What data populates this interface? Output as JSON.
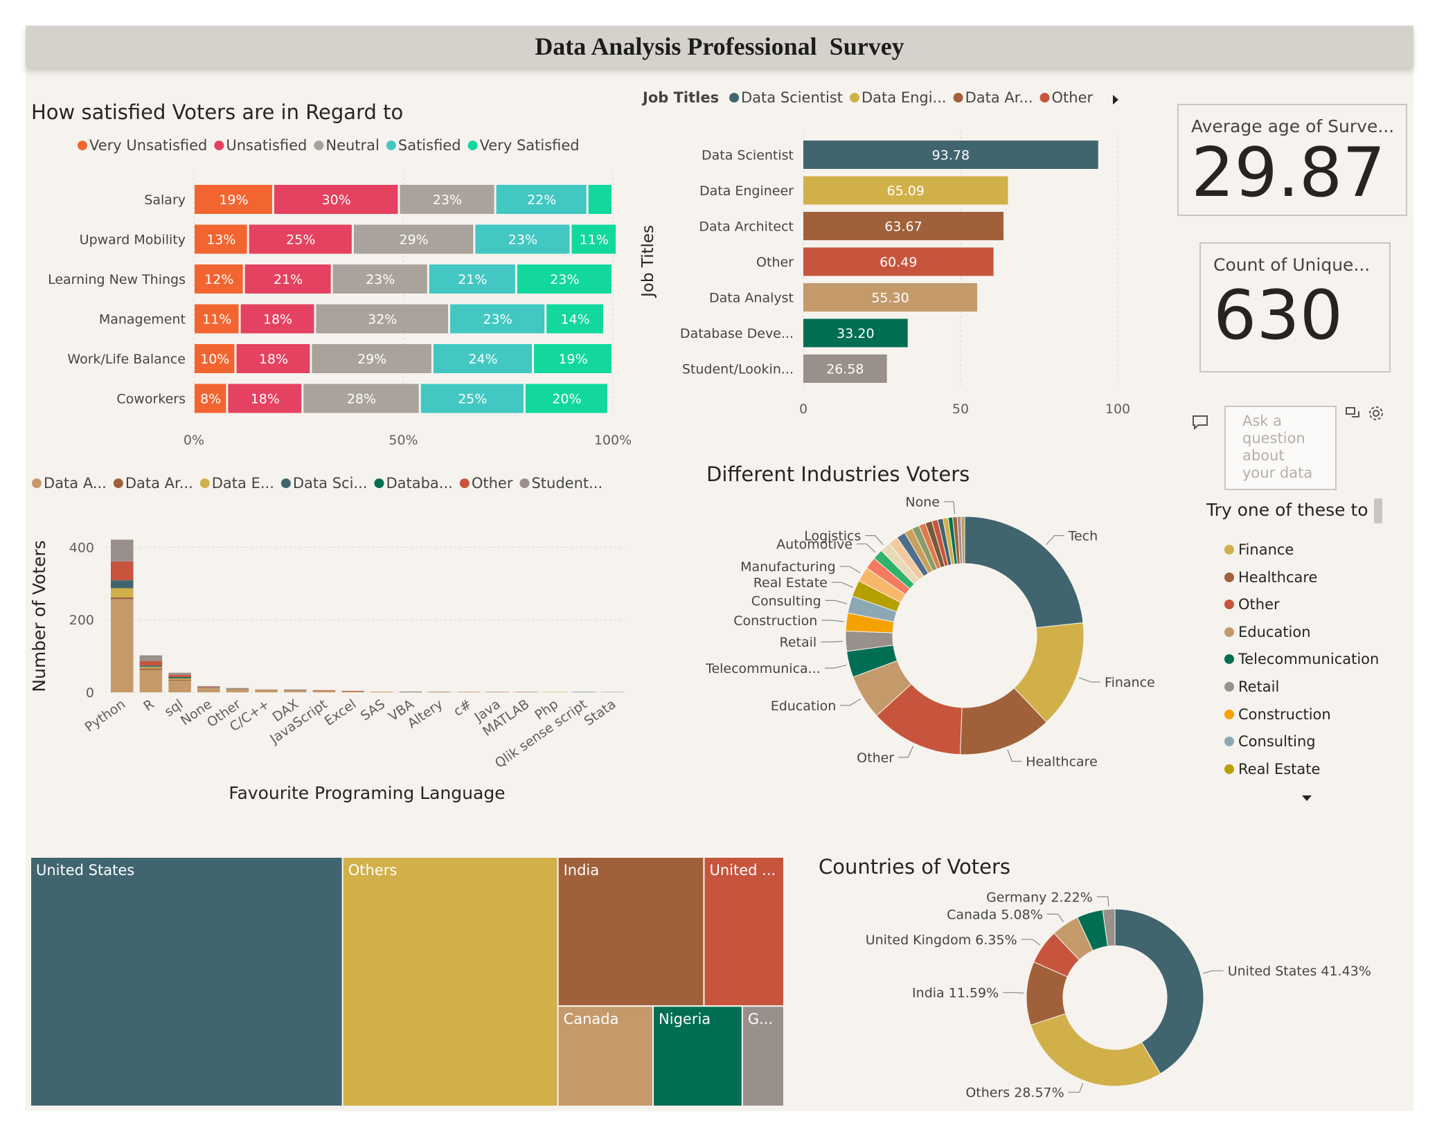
{
  "report": {
    "title": "Data Analysis Professional  Survey"
  },
  "colors": {
    "canvas": "#f6f3ee",
    "dark_teal": "#40656f",
    "gold": "#d1b04a",
    "brown": "#a0613a",
    "red": "#c7553d",
    "tan": "#c49a6a",
    "green": "#006e53",
    "gray": "#9a908a",
    "very_unsatisfied": "#f26531",
    "unsatisfied": "#e44260",
    "neutral": "#aaa39c",
    "satisfied": "#43c7c2",
    "very_satisfied": "#12d89d"
  },
  "satisfaction": {
    "title": "How satisfied Voters are in Regard to",
    "legend": [
      "Very Unsatisfied",
      "Unsatisfied",
      "Neutral",
      "Satisfied",
      "Very Satisfied"
    ],
    "legend_colors": [
      "#f26531",
      "#e44260",
      "#aaa39c",
      "#43c7c2",
      "#12d89d"
    ],
    "x_ticks": [
      "0%",
      "50%",
      "100%"
    ]
  },
  "job_titles": {
    "legend_title": "Job Titles",
    "legend": [
      "Data Scientist",
      "Data Engi...",
      "Data Ar...",
      "Other"
    ],
    "legend_colors": [
      "#40656f",
      "#d1b04a",
      "#a0613a",
      "#c7553d"
    ],
    "y_axis_title": "Job Titles",
    "x_ticks": [
      "0",
      "50",
      "100"
    ]
  },
  "avg_age_card": {
    "label": "Average age of Surve...",
    "value": "29.87"
  },
  "count_card": {
    "label": "Count of Unique...",
    "value": "630"
  },
  "languages": {
    "legend": [
      "Data A...",
      "Data Ar...",
      "Data E...",
      "Data Sci...",
      "Databa...",
      "Other",
      "Student..."
    ],
    "legend_colors": [
      "#c49a6a",
      "#a0613a",
      "#d1b04a",
      "#40656f",
      "#006e53",
      "#c7553d",
      "#9a908a"
    ],
    "x_axis_title": "Favourite Programing Language",
    "y_axis_title": "Number of Voters",
    "y_ticks": [
      "400",
      "200",
      "0"
    ]
  },
  "industries": {
    "title": "Different Industries Voters"
  },
  "countries_donut": {
    "title": "Countries of Voters"
  },
  "qna": {
    "placeholder": "Ask a question about your data",
    "try_text": "Try one of these to get started",
    "suggestions": [
      "Finance",
      "Healthcare",
      "Other",
      "Education",
      "Telecommunication",
      "Retail",
      "Construction",
      "Consulting",
      "Real Estate"
    ],
    "suggestion_colors": [
      "#d1b04a",
      "#a0613a",
      "#c7553d",
      "#c49a6a",
      "#006e53",
      "#9a908a",
      "#f5a100",
      "#8ca8b4",
      "#b5a000"
    ]
  },
  "chart_data": [
    {
      "type": "bar",
      "orientation": "horizontal",
      "stacked": "100%",
      "title": "How satisfied Voters are in Regard to",
      "categories": [
        "Salary",
        "Upward Mobility",
        "Learning New Things",
        "Management",
        "Work/Life Balance",
        "Coworkers"
      ],
      "series": [
        {
          "name": "Very Unsatisfied",
          "values": [
            19,
            13,
            12,
            11,
            10,
            8
          ],
          "labels": [
            "19%",
            "13%",
            "12%",
            "11%",
            "10%",
            "8%"
          ]
        },
        {
          "name": "Unsatisfied",
          "values": [
            30,
            25,
            21,
            18,
            18,
            18
          ],
          "labels": [
            "30%",
            "25%",
            "21%",
            "18%",
            "18%",
            "18%"
          ]
        },
        {
          "name": "Neutral",
          "values": [
            23,
            29,
            23,
            32,
            29,
            28
          ],
          "labels": [
            "23%",
            "29%",
            "23%",
            "32%",
            "29%",
            "28%"
          ]
        },
        {
          "name": "Satisfied",
          "values": [
            22,
            23,
            21,
            23,
            24,
            25
          ],
          "labels": [
            "22%",
            "23%",
            "21%",
            "23%",
            "24%",
            "25%"
          ]
        },
        {
          "name": "Very Satisfied",
          "values": [
            6,
            11,
            23,
            14,
            19,
            20
          ],
          "labels": [
            "",
            "11%",
            "23%",
            "14%",
            "19%",
            "20%"
          ]
        }
      ],
      "xlim": [
        0,
        100
      ],
      "grid": true,
      "legend": "top"
    },
    {
      "type": "bar",
      "orientation": "horizontal",
      "categories": [
        "Data Scientist",
        "Data Engineer",
        "Data Architect",
        "Other",
        "Data Analyst",
        "Database Deve...",
        "Student/Lookin..."
      ],
      "values": [
        93.78,
        65.09,
        63.67,
        60.49,
        55.3,
        33.2,
        26.58
      ],
      "labels": [
        "93.78",
        "65.09",
        "63.67",
        "60.49",
        "55.30",
        "33.20",
        "26.58"
      ],
      "colors": [
        "#40656f",
        "#d1b04a",
        "#a0613a",
        "#c7553d",
        "#c49a6a",
        "#006e53",
        "#9a908a"
      ],
      "ylabel": "Job Titles",
      "xlim": [
        0,
        100
      ],
      "grid": true,
      "legend": "top"
    },
    {
      "type": "bar",
      "stacked": true,
      "categories": [
        "Python",
        "R",
        "sql",
        "None",
        "Other",
        "C/C++",
        "DAX",
        "JavaScript",
        "Excel",
        "SAS",
        "VBA",
        "Altery",
        "c#",
        "Java",
        "MATLAB",
        "Php",
        "Qlik sense script",
        "Stata"
      ],
      "series": [
        {
          "name": "Data A...",
          "values": [
            257,
            62,
            32,
            10,
            6,
            4,
            4,
            4,
            2,
            1,
            1,
            1,
            0,
            0,
            0,
            0,
            0,
            0
          ]
        },
        {
          "name": "Data Ar...",
          "values": [
            5,
            4,
            3,
            1,
            1,
            1,
            0,
            1,
            1,
            0,
            0,
            0,
            1,
            1,
            1,
            0,
            0,
            0
          ]
        },
        {
          "name": "Data E...",
          "values": [
            25,
            4,
            3,
            1,
            1,
            1,
            1,
            0,
            0,
            1,
            0,
            0,
            0,
            0,
            0,
            1,
            0,
            0
          ]
        },
        {
          "name": "Data Sci...",
          "values": [
            22,
            4,
            3,
            1,
            1,
            0,
            1,
            0,
            0,
            0,
            1,
            0,
            0,
            0,
            0,
            0,
            1,
            0
          ]
        },
        {
          "name": "Databa...",
          "values": [
            0,
            0,
            1,
            0,
            0,
            0,
            0,
            0,
            0,
            0,
            0,
            0,
            0,
            0,
            0,
            0,
            0,
            0
          ]
        },
        {
          "name": "Other",
          "values": [
            52,
            12,
            6,
            2,
            1,
            1,
            1,
            1,
            1,
            0,
            0,
            0,
            0,
            0,
            0,
            0,
            0,
            0
          ]
        },
        {
          "name": "Student...",
          "values": [
            60,
            16,
            6,
            2,
            2,
            1,
            1,
            0,
            0,
            0,
            0,
            1,
            0,
            0,
            0,
            0,
            0,
            1
          ]
        }
      ],
      "xlabel": "Favourite Programing Language",
      "ylabel": "Number of Voters",
      "ylim": [
        0,
        420
      ],
      "grid": true,
      "legend": "top"
    },
    {
      "type": "pie",
      "donut": true,
      "title": "Different Industries Voters",
      "slices": [
        {
          "label": "Tech",
          "value": 23,
          "color": "#40656f"
        },
        {
          "label": "Finance",
          "value": 14.5,
          "color": "#d1b04a"
        },
        {
          "label": "Healthcare",
          "value": 12.5,
          "color": "#a0613a"
        },
        {
          "label": "Other",
          "value": 12.5,
          "color": "#c7553d"
        },
        {
          "label": "Education",
          "value": 6,
          "color": "#c49a6a"
        },
        {
          "label": "Telecommunica...",
          "value": 3.5,
          "color": "#006e53"
        },
        {
          "label": "Retail",
          "value": 2.7,
          "color": "#9a908a"
        },
        {
          "label": "Construction",
          "value": 2.4,
          "color": "#f5a100"
        },
        {
          "label": "Consulting",
          "value": 2.3,
          "color": "#8ca8b4"
        },
        {
          "label": "Real Estate",
          "value": 2.2,
          "color": "#b5a000"
        },
        {
          "label": "Manufacturing",
          "value": 2.0,
          "color": "#f7b86a"
        },
        {
          "label": "",
          "value": 1.6,
          "color": "#f47a60"
        },
        {
          "label": "Automotive",
          "value": 1.4,
          "color": "#2fb36b"
        },
        {
          "label": "Logistics",
          "value": 1.4,
          "color": "#e8d9b8"
        },
        {
          "label": "",
          "value": 1.3,
          "color": "#f2c9a0"
        },
        {
          "label": "",
          "value": 1.2,
          "color": "#4f6e8a"
        },
        {
          "label": "",
          "value": 1.1,
          "color": "#c9a05a"
        },
        {
          "label": "",
          "value": 1.0,
          "color": "#8a9b6a"
        },
        {
          "label": "",
          "value": 0.9,
          "color": "#e07a4a"
        },
        {
          "label": "",
          "value": 0.9,
          "color": "#7a5a3a"
        },
        {
          "label": "",
          "value": 0.8,
          "color": "#c7553d"
        },
        {
          "label": "",
          "value": 0.7,
          "color": "#40656f"
        },
        {
          "label": "",
          "value": 0.7,
          "color": "#d1b04a"
        },
        {
          "label": "",
          "value": 0.6,
          "color": "#006e53"
        },
        {
          "label": "None",
          "value": 0.6,
          "color": "#a0613a"
        },
        {
          "label": "",
          "value": 0.5,
          "color": "#9a908a"
        },
        {
          "label": "",
          "value": 0.5,
          "color": "#c49a6a"
        }
      ],
      "legend": "none"
    },
    {
      "type": "treemap",
      "cells": [
        {
          "label": "United States",
          "value": 261,
          "color": "#40656f"
        },
        {
          "label": "Others",
          "value": 180,
          "color": "#d1b04a"
        },
        {
          "label": "India",
          "value": 73,
          "color": "#a0613a"
        },
        {
          "label": "United ...",
          "value": 40,
          "color": "#c7553d"
        },
        {
          "label": "Canada",
          "value": 32,
          "color": "#c49a6a"
        },
        {
          "label": "Nigeria",
          "value": 30,
          "color": "#006e53"
        },
        {
          "label": "G...",
          "value": 14,
          "color": "#9a908a"
        }
      ]
    },
    {
      "type": "pie",
      "donut": true,
      "title": "Countries of Voters",
      "slices": [
        {
          "label": "United States",
          "value": 41.43,
          "display": "United States 41.43%",
          "color": "#40656f"
        },
        {
          "label": "Others",
          "value": 28.57,
          "display": "Others 28.57%",
          "color": "#d1b04a"
        },
        {
          "label": "India",
          "value": 11.59,
          "display": "India 11.59%",
          "color": "#a0613a"
        },
        {
          "label": "United Kingdom",
          "value": 6.35,
          "display": "United Kingdom 6.35%",
          "color": "#c7553d"
        },
        {
          "label": "Canada",
          "value": 5.08,
          "display": "Canada 5.08%",
          "color": "#c49a6a"
        },
        {
          "label": "Nigeria",
          "value": 4.76,
          "display": "",
          "color": "#006e53"
        },
        {
          "label": "Germany",
          "value": 2.22,
          "display": "Germany 2.22%",
          "color": "#9a908a"
        }
      ],
      "legend": "none"
    }
  ]
}
